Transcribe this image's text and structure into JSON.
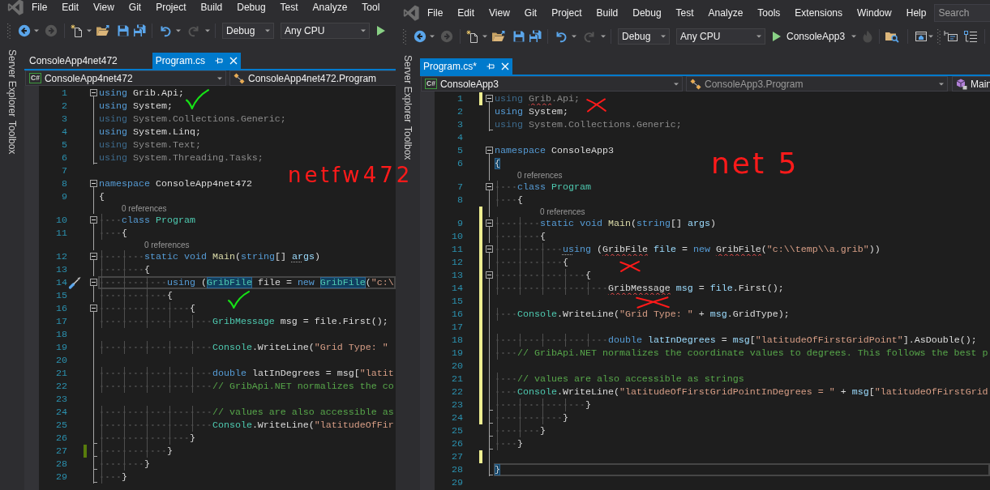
{
  "windows": [
    {
      "menu": [
        "File",
        "Edit",
        "View",
        "Git",
        "Project",
        "Build",
        "Debug",
        "Test",
        "Analyze",
        "Tool"
      ],
      "toolbar": {
        "configuration": "Debug",
        "platform": "Any CPU"
      },
      "side_tabs": [
        "Server Explorer",
        "Toolbox"
      ],
      "tabs": [
        {
          "label": "ConsoleApp4net472",
          "selected": false
        },
        {
          "label": "Program.cs",
          "selected": true
        }
      ],
      "navigation": {
        "project": {
          "badge": "C#",
          "label": "ConsoleApp4net472"
        },
        "type": {
          "label": "ConsoleApp4net472.Program",
          "dimmed": false
        }
      },
      "lines": [
        {
          "number": "1",
          "collapsible": true,
          "tokens": [
            {
              "kind": "keyword",
              "text": "using"
            },
            {
              "kind": "plain",
              "text": " Grib.Api;"
            }
          ]
        },
        {
          "number": "2",
          "in_region": true,
          "tokens": [
            {
              "kind": "keyword",
              "text": "using"
            },
            {
              "kind": "plain",
              "text": " System;"
            }
          ]
        },
        {
          "number": "3",
          "in_region": true,
          "tokens": [
            {
              "kind": "keyword",
              "text": "using",
              "faded": true
            },
            {
              "kind": "plain",
              "text": " System.Collections.Generic;",
              "faded": true
            }
          ]
        },
        {
          "number": "4",
          "in_region": true,
          "tokens": [
            {
              "kind": "keyword",
              "text": "using"
            },
            {
              "kind": "plain",
              "text": " System.Linq;"
            }
          ]
        },
        {
          "number": "5",
          "in_region": true,
          "tokens": [
            {
              "kind": "keyword",
              "text": "using",
              "faded": true
            },
            {
              "kind": "plain",
              "text": " System.Text;",
              "faded": true
            }
          ]
        },
        {
          "number": "6",
          "region_end": true,
          "tokens": [
            {
              "kind": "keyword",
              "text": "using",
              "faded": true
            },
            {
              "kind": "plain",
              "text": " System.Threading.Tasks;",
              "faded": true
            }
          ]
        },
        {
          "number": "7"
        },
        {
          "number": "8",
          "collapsible": true,
          "tokens": [
            {
              "kind": "keyword",
              "text": "namespace"
            },
            {
              "kind": "plain",
              "text": " ConsoleApp4net472"
            }
          ]
        },
        {
          "number": "9",
          "in_region": true,
          "tokens": [
            {
              "kind": "plain",
              "text": "{"
            }
          ]
        },
        {
          "number": "10",
          "lens": "0 references",
          "collapsible": true,
          "tokens": [
            {
              "kind": "keyword",
              "text": "    class"
            },
            {
              "kind": "type",
              "text": " Program"
            }
          ]
        },
        {
          "number": "11",
          "in_region": true,
          "tokens": [
            {
              "kind": "plain",
              "text": "    {"
            }
          ]
        },
        {
          "number": "12",
          "lens": "0 references",
          "collapsible": true,
          "tokens": [
            {
              "kind": "keyword",
              "text": "        static"
            },
            {
              "kind": "keyword",
              "text": " void"
            },
            {
              "kind": "method",
              "text": " Main"
            },
            {
              "kind": "plain",
              "text": "("
            },
            {
              "kind": "keyword",
              "text": "string"
            },
            {
              "kind": "plain",
              "text": "[] "
            },
            {
              "kind": "variable",
              "text": "ar",
              "suggestion": true
            },
            {
              "kind": "variable",
              "text": "gs"
            },
            {
              "kind": "plain",
              "text": ")"
            }
          ]
        },
        {
          "number": "13",
          "in_region": true,
          "tokens": [
            {
              "kind": "plain",
              "text": "        {"
            }
          ]
        },
        {
          "number": "14",
          "collapsible": true,
          "current": true,
          "quick_actions": true,
          "tokens": [
            {
              "kind": "keyword",
              "text": "            using"
            },
            {
              "kind": "plain",
              "text": " ("
            },
            {
              "kind": "type",
              "text": "GribFile",
              "highlight": true
            },
            {
              "kind": "plain",
              "text": " file = "
            },
            {
              "kind": "keyword",
              "text": "new "
            },
            {
              "kind": "type",
              "text": "GribFile",
              "highlight": true
            },
            {
              "kind": "plain",
              "text": "("
            },
            {
              "kind": "string",
              "text": "\"c:\\"
            }
          ]
        },
        {
          "number": "15",
          "in_region": true,
          "tokens": [
            {
              "kind": "plain",
              "text": "            {"
            }
          ]
        },
        {
          "number": "16",
          "collapsible": true,
          "tokens": [
            {
              "kind": "plain",
              "text": "                {"
            }
          ]
        },
        {
          "number": "17",
          "in_region": true,
          "tokens": [
            {
              "kind": "type",
              "text": "                    GribMessage"
            },
            {
              "kind": "plain",
              "text": " msg = file.First();"
            }
          ]
        },
        {
          "number": "18",
          "in_region": true
        },
        {
          "number": "19",
          "in_region": true,
          "tokens": [
            {
              "kind": "type",
              "text": "                    Console"
            },
            {
              "kind": "plain",
              "text": ".WriteLine("
            },
            {
              "kind": "string",
              "text": "\"Grid Type: \""
            }
          ]
        },
        {
          "number": "20",
          "in_region": true
        },
        {
          "number": "21",
          "in_region": true,
          "tokens": [
            {
              "kind": "keyword",
              "text": "                    double"
            },
            {
              "kind": "plain",
              "text": " latInDegrees = msg["
            },
            {
              "kind": "string",
              "text": "\"latit"
            }
          ]
        },
        {
          "number": "22",
          "in_region": true,
          "tokens": [
            {
              "kind": "comment",
              "text": "                    // GribApi.NET normalizes the co"
            }
          ]
        },
        {
          "number": "23",
          "in_region": true
        },
        {
          "number": "24",
          "in_region": true,
          "tokens": [
            {
              "kind": "comment",
              "text": "                    // values are also accessible as"
            }
          ]
        },
        {
          "number": "25",
          "in_region": true,
          "tokens": [
            {
              "kind": "type",
              "text": "                    Console"
            },
            {
              "kind": "plain",
              "text": ".WriteLine("
            },
            {
              "kind": "string",
              "text": "\"latitudeOfFir"
            }
          ]
        },
        {
          "number": "26",
          "region_end": true,
          "tokens": [
            {
              "kind": "plain",
              "text": "                }"
            }
          ]
        },
        {
          "number": "27",
          "region_end": true,
          "changed": true,
          "saved": true,
          "tokens": [
            {
              "kind": "plain",
              "text": "            }"
            }
          ]
        },
        {
          "number": "28",
          "region_end": true,
          "tokens": [
            {
              "kind": "plain",
              "text": "        }"
            }
          ]
        },
        {
          "number": "29",
          "region_end": true,
          "tokens": [
            {
              "kind": "plain",
              "text": "    }"
            }
          ]
        }
      ]
    },
    {
      "menu": [
        "File",
        "Edit",
        "View",
        "Git",
        "Project",
        "Build",
        "Debug",
        "Test",
        "Analyze",
        "Tools",
        "Extensions",
        "Window",
        "Help"
      ],
      "search": {
        "placeholder": "Search"
      },
      "toolbar": {
        "configuration": "Debug",
        "platform": "Any CPU",
        "start_label": "ConsoleApp3"
      },
      "side_tabs": [
        "Server Explorer",
        "Toolbox"
      ],
      "tabs": [
        {
          "label": "Program.cs*",
          "selected": true
        }
      ],
      "navigation": {
        "project": {
          "badge": "C#",
          "label": "ConsoleApp3"
        },
        "type": {
          "label": "ConsoleApp3.Program",
          "dimmed": true
        },
        "member": {
          "label": "Main"
        }
      },
      "lines": [
        {
          "number": "1",
          "collapsible": true,
          "changed": true,
          "saved": false,
          "tokens": [
            {
              "kind": "keyword",
              "text": "using ",
              "faded": true
            },
            {
              "kind": "plain",
              "text": "Grib",
              "faded": true,
              "squiggle": true
            },
            {
              "kind": "plain",
              "text": ".Api;",
              "faded": true
            }
          ]
        },
        {
          "number": "2",
          "in_region": true,
          "tokens": [
            {
              "kind": "keyword",
              "text": "using"
            },
            {
              "kind": "plain",
              "text": " System;"
            }
          ]
        },
        {
          "number": "3",
          "region_end": true,
          "tokens": [
            {
              "kind": "keyword",
              "text": "using",
              "faded": true
            },
            {
              "kind": "plain",
              "text": " System.Collections.Generic;",
              "faded": true
            }
          ]
        },
        {
          "number": "4"
        },
        {
          "number": "5",
          "collapsible": true,
          "tokens": [
            {
              "kind": "keyword",
              "text": "namespace"
            },
            {
              "kind": "plain",
              "text": " ConsoleApp3"
            }
          ]
        },
        {
          "number": "6",
          "in_region": true,
          "tokens": [
            {
              "kind": "plain",
              "text": "{",
              "highlight": true
            }
          ]
        },
        {
          "number": "7",
          "lens": "0 references",
          "collapsible": true,
          "tokens": [
            {
              "kind": "keyword",
              "text": "    class"
            },
            {
              "kind": "type",
              "text": " Program"
            }
          ]
        },
        {
          "number": "8",
          "in_region": true,
          "tokens": [
            {
              "kind": "plain",
              "text": "    {"
            }
          ]
        },
        {
          "number": "9",
          "lens": "0 references",
          "collapsible": true,
          "changed": true,
          "saved": false,
          "tokens": [
            {
              "kind": "keyword",
              "text": "        static"
            },
            {
              "kind": "keyword",
              "text": " void"
            },
            {
              "kind": "method",
              "text": " Main"
            },
            {
              "kind": "plain",
              "text": "("
            },
            {
              "kind": "keyword",
              "text": "string"
            },
            {
              "kind": "plain",
              "text": "[] "
            },
            {
              "kind": "variable",
              "text": "args"
            },
            {
              "kind": "plain",
              "text": ")"
            }
          ]
        },
        {
          "number": "10",
          "in_region": true,
          "changed": true,
          "saved": false,
          "tokens": [
            {
              "kind": "plain",
              "text": "        {"
            }
          ]
        },
        {
          "number": "11",
          "collapsible": true,
          "changed": true,
          "saved": false,
          "tokens": [
            {
              "kind": "keyword",
              "text": "            us",
              "suggestion": true
            },
            {
              "kind": "keyword",
              "text": "ing"
            },
            {
              "kind": "plain",
              "text": " ("
            },
            {
              "kind": "plain",
              "text": "GribFile",
              "squiggle": true
            },
            {
              "kind": "variable",
              "text": " file"
            },
            {
              "kind": "plain",
              "text": " = "
            },
            {
              "kind": "keyword",
              "text": "new "
            },
            {
              "kind": "plain",
              "text": "GribFile",
              "squiggle": true
            },
            {
              "kind": "plain",
              "text": "("
            },
            {
              "kind": "string",
              "text": "\"c:\\\\temp\\\\a.grib\""
            },
            {
              "kind": "plain",
              "text": "))"
            }
          ]
        },
        {
          "number": "12",
          "in_region": true,
          "changed": true,
          "saved": false,
          "tokens": [
            {
              "kind": "plain",
              "text": "            {"
            }
          ]
        },
        {
          "number": "13",
          "collapsible": true,
          "changed": true,
          "saved": false,
          "tokens": [
            {
              "kind": "plain",
              "text": "                {"
            }
          ]
        },
        {
          "number": "14",
          "in_region": true,
          "changed": true,
          "saved": false,
          "tokens": [
            {
              "kind": "plain",
              "text": "                    GribMessage",
              "squiggle": true
            },
            {
              "kind": "variable",
              "text": " msg"
            },
            {
              "kind": "plain",
              "text": " = "
            },
            {
              "kind": "variable",
              "text": "file"
            },
            {
              "kind": "plain",
              "text": ".First();"
            }
          ]
        },
        {
          "number": "15",
          "in_region": true,
          "changed": true,
          "saved": false
        },
        {
          "number": "16",
          "in_region": true,
          "changed": true,
          "saved": false,
          "tokens": [
            {
              "kind": "type",
              "text": "    Console"
            },
            {
              "kind": "plain",
              "text": ".WriteLine("
            },
            {
              "kind": "string",
              "text": "\"Grid Type: \""
            },
            {
              "kind": "plain",
              "text": " + "
            },
            {
              "kind": "variable",
              "text": "msg"
            },
            {
              "kind": "plain",
              "text": ".GridType);"
            }
          ]
        },
        {
          "number": "17",
          "in_region": true,
          "changed": true,
          "saved": false
        },
        {
          "number": "18",
          "in_region": true,
          "changed": true,
          "saved": false,
          "tokens": [
            {
              "kind": "keyword",
              "text": "                    double"
            },
            {
              "kind": "variable",
              "text": " latInDegrees"
            },
            {
              "kind": "plain",
              "text": " = "
            },
            {
              "kind": "variable",
              "text": "msg"
            },
            {
              "kind": "plain",
              "text": "["
            },
            {
              "kind": "string",
              "text": "\"latitudeOfFirstGridPoint\""
            },
            {
              "kind": "plain",
              "text": "].AsDouble();"
            }
          ]
        },
        {
          "number": "19",
          "in_region": true,
          "changed": true,
          "saved": false,
          "tokens": [
            {
              "kind": "comment",
              "text": "    // GribApi.NET normalizes the coordinate values to degrees. This follows the best p"
            }
          ]
        },
        {
          "number": "20",
          "in_region": true,
          "changed": true,
          "saved": false
        },
        {
          "number": "21",
          "in_region": true,
          "changed": true,
          "saved": false,
          "tokens": [
            {
              "kind": "comment",
              "text": "    // values are also accessible as strings"
            }
          ]
        },
        {
          "number": "22",
          "in_region": true,
          "changed": true,
          "saved": false,
          "tokens": [
            {
              "kind": "type",
              "text": "    Console"
            },
            {
              "kind": "plain",
              "text": ".WriteLine("
            },
            {
              "kind": "string",
              "text": "\"latitudeOfFirstGridPointInDegrees = \""
            },
            {
              "kind": "plain",
              "text": " + "
            },
            {
              "kind": "variable",
              "text": "msg"
            },
            {
              "kind": "plain",
              "text": "["
            },
            {
              "kind": "string",
              "text": "\"latitudeOfFirstGrid"
            }
          ]
        },
        {
          "number": "23",
          "region_end": true,
          "changed": true,
          "saved": false,
          "tokens": [
            {
              "kind": "plain",
              "text": "                }"
            }
          ]
        },
        {
          "number": "24",
          "region_end": true,
          "changed": true,
          "saved": false,
          "tokens": [
            {
              "kind": "plain",
              "text": "            }"
            }
          ]
        },
        {
          "number": "25",
          "region_end": true,
          "tokens": [
            {
              "kind": "plain",
              "text": "        }"
            }
          ]
        },
        {
          "number": "26",
          "region_end": true,
          "tokens": [
            {
              "kind": "plain",
              "text": "    }"
            }
          ]
        },
        {
          "number": "27",
          "in_region": true,
          "changed": true,
          "saved": false
        },
        {
          "number": "28",
          "region_end": true,
          "current": true,
          "tokens": [
            {
              "kind": "plain",
              "text": "}",
              "highlight": true
            }
          ]
        },
        {
          "number": "29"
        }
      ]
    }
  ],
  "annotations": [
    {
      "kind": "check"
    },
    {
      "kind": "cross"
    },
    {
      "kind": "text",
      "text": "net 5"
    },
    {
      "kind": "text",
      "text": "netfw472"
    },
    {
      "kind": "cross"
    },
    {
      "kind": "check"
    },
    {
      "kind": "cross"
    }
  ]
}
